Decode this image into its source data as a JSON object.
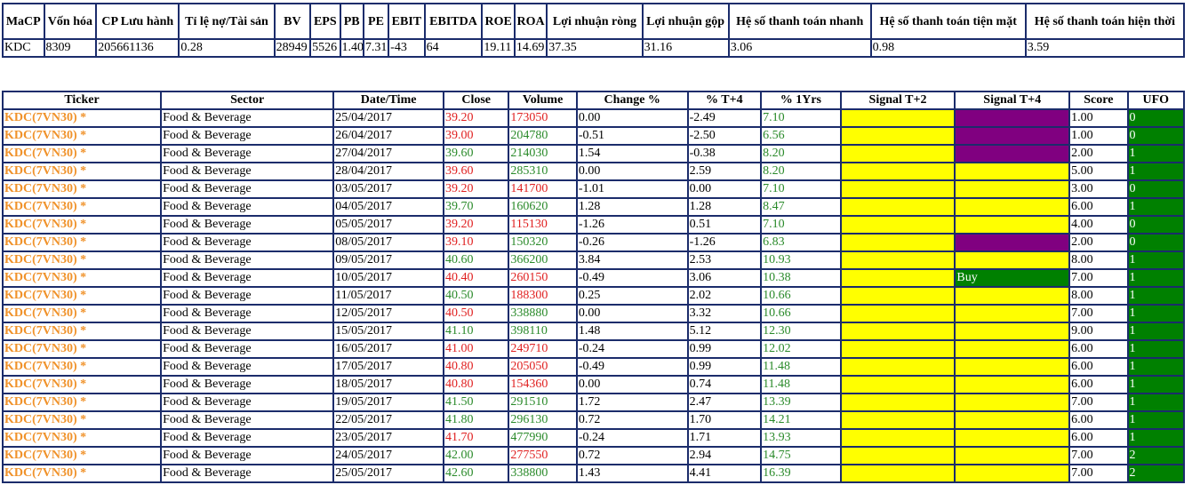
{
  "colors": {
    "border": "#1b2c6b",
    "ticker": "#f0922a",
    "up": "#2a8a2a",
    "down": "#e02020",
    "yellow": "#ffff00",
    "purple": "#800080",
    "green": "#008000"
  },
  "financials": {
    "headers": [
      "MaCP",
      "Vốn hóa",
      "CP Lưu hành",
      "Tỉ lệ nợ/Tài sản",
      "BV",
      "EPS",
      "PB",
      "PE",
      "EBIT",
      "EBITDA",
      "ROE",
      "ROA",
      "Lợi nhuận ròng",
      "Lợi nhuận gộp",
      "Hệ số thanh toán nhanh",
      "Hệ số thanh toán tiện mặt",
      "Hệ số thanh toán hiện thời"
    ],
    "row": [
      "KDC",
      "8309",
      "205661136",
      "0.28",
      "28949",
      "5526",
      "1.40",
      "7.31",
      "-43",
      "64",
      "19.11",
      "14.69",
      "37.35",
      "31.16",
      "3.06",
      "0.98",
      "3.59"
    ]
  },
  "signals": {
    "headers": [
      "Ticker",
      "Sector",
      "Date/Time",
      "Close",
      "Volume",
      "Change %",
      "% T+4",
      "% 1Yrs",
      "Signal T+2",
      "Signal T+4",
      "Score",
      "UFO"
    ],
    "rows": [
      {
        "ticker": "KDC(7VN30) *",
        "sector": "Food & Beverage",
        "date": "25/04/2017",
        "close": "39.20",
        "close_dir": "down",
        "volume": "173050",
        "volume_dir": "down",
        "change": "0.00",
        "t4": "-2.49",
        "yr": "7.10",
        "sig2": "",
        "sig2_color": "yellow",
        "sig4": "",
        "sig4_color": "purple",
        "score": "1.00",
        "ufo": "0"
      },
      {
        "ticker": "KDC(7VN30) *",
        "sector": "Food & Beverage",
        "date": "26/04/2017",
        "close": "39.00",
        "close_dir": "down",
        "volume": "204780",
        "volume_dir": "up",
        "change": "-0.51",
        "t4": "-2.50",
        "yr": "6.56",
        "sig2": "",
        "sig2_color": "yellow",
        "sig4": "",
        "sig4_color": "purple",
        "score": "1.00",
        "ufo": "0"
      },
      {
        "ticker": "KDC(7VN30) *",
        "sector": "Food & Beverage",
        "date": "27/04/2017",
        "close": "39.60",
        "close_dir": "up",
        "volume": "214030",
        "volume_dir": "up",
        "change": "1.54",
        "t4": "-0.38",
        "yr": "8.20",
        "sig2": "",
        "sig2_color": "yellow",
        "sig4": "",
        "sig4_color": "purple",
        "score": "2.00",
        "ufo": "1"
      },
      {
        "ticker": "KDC(7VN30) *",
        "sector": "Food & Beverage",
        "date": "28/04/2017",
        "close": "39.60",
        "close_dir": "down",
        "volume": "285310",
        "volume_dir": "up",
        "change": "0.00",
        "t4": "2.59",
        "yr": "8.20",
        "sig2": "",
        "sig2_color": "yellow",
        "sig4": "",
        "sig4_color": "yellow",
        "score": "5.00",
        "ufo": "1"
      },
      {
        "ticker": "KDC(7VN30) *",
        "sector": "Food & Beverage",
        "date": "03/05/2017",
        "close": "39.20",
        "close_dir": "down",
        "volume": "141700",
        "volume_dir": "down",
        "change": "-1.01",
        "t4": "0.00",
        "yr": "7.10",
        "sig2": "",
        "sig2_color": "yellow",
        "sig4": "",
        "sig4_color": "yellow",
        "score": "3.00",
        "ufo": "0"
      },
      {
        "ticker": "KDC(7VN30) *",
        "sector": "Food & Beverage",
        "date": "04/05/2017",
        "close": "39.70",
        "close_dir": "up",
        "volume": "160620",
        "volume_dir": "up",
        "change": "1.28",
        "t4": "1.28",
        "yr": "8.47",
        "sig2": "",
        "sig2_color": "yellow",
        "sig4": "",
        "sig4_color": "yellow",
        "score": "6.00",
        "ufo": "1"
      },
      {
        "ticker": "KDC(7VN30) *",
        "sector": "Food & Beverage",
        "date": "05/05/2017",
        "close": "39.20",
        "close_dir": "down",
        "volume": "115130",
        "volume_dir": "down",
        "change": "-1.26",
        "t4": "0.51",
        "yr": "7.10",
        "sig2": "",
        "sig2_color": "yellow",
        "sig4": "",
        "sig4_color": "yellow",
        "score": "4.00",
        "ufo": "0"
      },
      {
        "ticker": "KDC(7VN30) *",
        "sector": "Food & Beverage",
        "date": "08/05/2017",
        "close": "39.10",
        "close_dir": "down",
        "volume": "150320",
        "volume_dir": "up",
        "change": "-0.26",
        "t4": "-1.26",
        "yr": "6.83",
        "sig2": "",
        "sig2_color": "yellow",
        "sig4": "",
        "sig4_color": "purple",
        "score": "2.00",
        "ufo": "0"
      },
      {
        "ticker": "KDC(7VN30) *",
        "sector": "Food & Beverage",
        "date": "09/05/2017",
        "close": "40.60",
        "close_dir": "up",
        "volume": "366200",
        "volume_dir": "up",
        "change": "3.84",
        "t4": "2.53",
        "yr": "10.93",
        "sig2": "",
        "sig2_color": "yellow",
        "sig4": "",
        "sig4_color": "yellow",
        "score": "8.00",
        "ufo": "1"
      },
      {
        "ticker": "KDC(7VN30) *",
        "sector": "Food & Beverage",
        "date": "10/05/2017",
        "close": "40.40",
        "close_dir": "down",
        "volume": "260150",
        "volume_dir": "down",
        "change": "-0.49",
        "t4": "3.06",
        "yr": "10.38",
        "sig2": "",
        "sig2_color": "yellow",
        "sig4": "Buy",
        "sig4_color": "green",
        "score": "7.00",
        "ufo": "1"
      },
      {
        "ticker": "KDC(7VN30) *",
        "sector": "Food & Beverage",
        "date": "11/05/2017",
        "close": "40.50",
        "close_dir": "up",
        "volume": "188300",
        "volume_dir": "down",
        "change": "0.25",
        "t4": "2.02",
        "yr": "10.66",
        "sig2": "",
        "sig2_color": "yellow",
        "sig4": "",
        "sig4_color": "yellow",
        "score": "8.00",
        "ufo": "1"
      },
      {
        "ticker": "KDC(7VN30) *",
        "sector": "Food & Beverage",
        "date": "12/05/2017",
        "close": "40.50",
        "close_dir": "down",
        "volume": "338880",
        "volume_dir": "up",
        "change": "0.00",
        "t4": "3.32",
        "yr": "10.66",
        "sig2": "",
        "sig2_color": "yellow",
        "sig4": "",
        "sig4_color": "yellow",
        "score": "7.00",
        "ufo": "1"
      },
      {
        "ticker": "KDC(7VN30) *",
        "sector": "Food & Beverage",
        "date": "15/05/2017",
        "close": "41.10",
        "close_dir": "up",
        "volume": "398110",
        "volume_dir": "up",
        "change": "1.48",
        "t4": "5.12",
        "yr": "12.30",
        "sig2": "",
        "sig2_color": "yellow",
        "sig4": "",
        "sig4_color": "yellow",
        "score": "9.00",
        "ufo": "1"
      },
      {
        "ticker": "KDC(7VN30) *",
        "sector": "Food & Beverage",
        "date": "16/05/2017",
        "close": "41.00",
        "close_dir": "down",
        "volume": "249710",
        "volume_dir": "down",
        "change": "-0.24",
        "t4": "0.99",
        "yr": "12.02",
        "sig2": "",
        "sig2_color": "yellow",
        "sig4": "",
        "sig4_color": "yellow",
        "score": "6.00",
        "ufo": "1"
      },
      {
        "ticker": "KDC(7VN30) *",
        "sector": "Food & Beverage",
        "date": "17/05/2017",
        "close": "40.80",
        "close_dir": "down",
        "volume": "205050",
        "volume_dir": "down",
        "change": "-0.49",
        "t4": "0.99",
        "yr": "11.48",
        "sig2": "",
        "sig2_color": "yellow",
        "sig4": "",
        "sig4_color": "yellow",
        "score": "6.00",
        "ufo": "1"
      },
      {
        "ticker": "KDC(7VN30) *",
        "sector": "Food & Beverage",
        "date": "18/05/2017",
        "close": "40.80",
        "close_dir": "down",
        "volume": "154360",
        "volume_dir": "down",
        "change": "0.00",
        "t4": "0.74",
        "yr": "11.48",
        "sig2": "",
        "sig2_color": "yellow",
        "sig4": "",
        "sig4_color": "yellow",
        "score": "6.00",
        "ufo": "1"
      },
      {
        "ticker": "KDC(7VN30) *",
        "sector": "Food & Beverage",
        "date": "19/05/2017",
        "close": "41.50",
        "close_dir": "up",
        "volume": "291510",
        "volume_dir": "up",
        "change": "1.72",
        "t4": "2.47",
        "yr": "13.39",
        "sig2": "",
        "sig2_color": "yellow",
        "sig4": "",
        "sig4_color": "yellow",
        "score": "7.00",
        "ufo": "1"
      },
      {
        "ticker": "KDC(7VN30) *",
        "sector": "Food & Beverage",
        "date": "22/05/2017",
        "close": "41.80",
        "close_dir": "up",
        "volume": "296130",
        "volume_dir": "up",
        "change": "0.72",
        "t4": "1.70",
        "yr": "14.21",
        "sig2": "",
        "sig2_color": "yellow",
        "sig4": "",
        "sig4_color": "yellow",
        "score": "6.00",
        "ufo": "1"
      },
      {
        "ticker": "KDC(7VN30) *",
        "sector": "Food & Beverage",
        "date": "23/05/2017",
        "close": "41.70",
        "close_dir": "down",
        "volume": "477990",
        "volume_dir": "up",
        "change": "-0.24",
        "t4": "1.71",
        "yr": "13.93",
        "sig2": "",
        "sig2_color": "yellow",
        "sig4": "",
        "sig4_color": "yellow",
        "score": "6.00",
        "ufo": "1"
      },
      {
        "ticker": "KDC(7VN30) *",
        "sector": "Food & Beverage",
        "date": "24/05/2017",
        "close": "42.00",
        "close_dir": "up",
        "volume": "277550",
        "volume_dir": "down",
        "change": "0.72",
        "t4": "2.94",
        "yr": "14.75",
        "sig2": "",
        "sig2_color": "yellow",
        "sig4": "",
        "sig4_color": "yellow",
        "score": "7.00",
        "ufo": "2"
      },
      {
        "ticker": "KDC(7VN30) *",
        "sector": "Food & Beverage",
        "date": "25/05/2017",
        "close": "42.60",
        "close_dir": "up",
        "volume": "338800",
        "volume_dir": "up",
        "change": "1.43",
        "t4": "4.41",
        "yr": "16.39",
        "sig2": "",
        "sig2_color": "yellow",
        "sig4": "",
        "sig4_color": "yellow",
        "score": "7.00",
        "ufo": "2"
      }
    ]
  }
}
